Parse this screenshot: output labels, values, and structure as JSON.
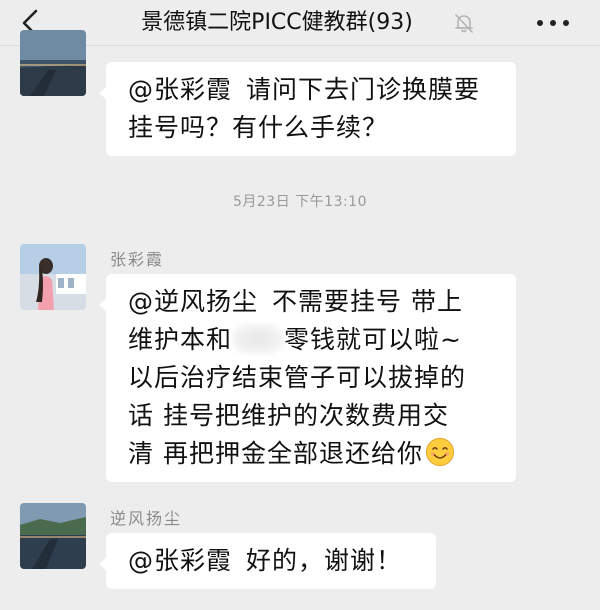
{
  "header": {
    "title": "景德镇二院PICC健教群(93)"
  },
  "messages": [
    {
      "sender": "",
      "mention": "@张彩霞",
      "lines": [
        "请问下去门诊换膜要",
        "挂号吗？有什么手续？"
      ]
    },
    {
      "sender": "张彩霞",
      "mention": "@逆风扬尘",
      "lines": [
        "不需要挂号 带上",
        "维护本和",
        "零钱就可以啦~",
        "以后治疗结束管子可以拔掉的",
        "话 挂号把维护的次数费用交",
        "清 再把押金全部退还给你"
      ]
    },
    {
      "sender": "逆风扬尘",
      "mention": "@张彩霞",
      "lines": [
        "好的，谢谢！"
      ]
    }
  ],
  "timestamp": "5月23日 下午13:10",
  "icons": {
    "back": "back-arrow-icon",
    "mute": "bell-muted-icon",
    "more": "more-dots-icon",
    "emoji": "smile-emoji-icon"
  },
  "colors": {
    "background": "#ededed",
    "bubble": "#ffffff",
    "meta_text": "#8a8a8a"
  }
}
